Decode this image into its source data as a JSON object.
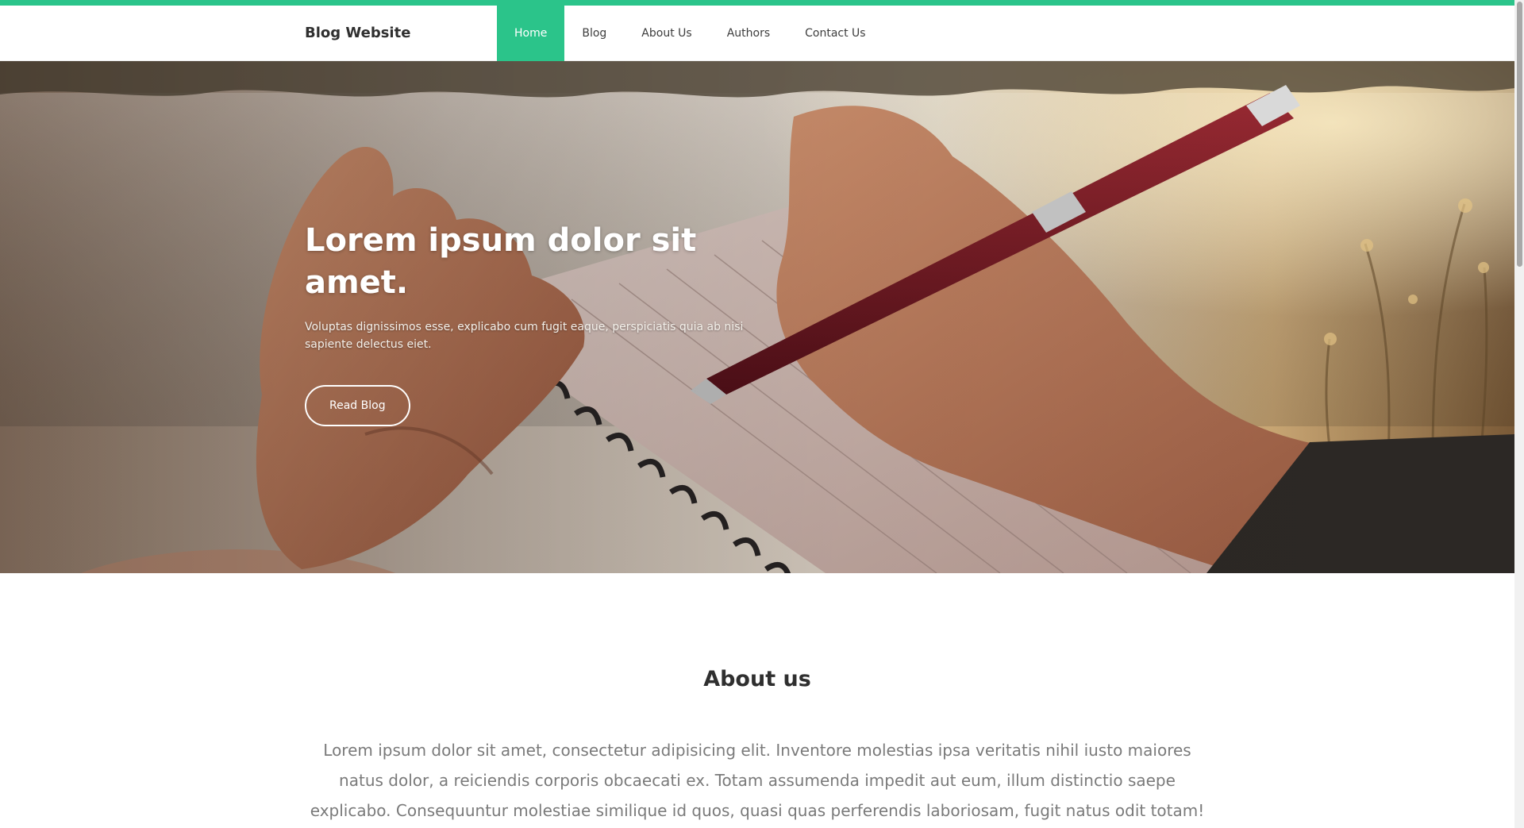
{
  "navbar": {
    "brand": "Blog Website",
    "links": [
      {
        "label": "Home",
        "active": true
      },
      {
        "label": "Blog",
        "active": false
      },
      {
        "label": "About Us",
        "active": false
      },
      {
        "label": "Authors",
        "active": false
      },
      {
        "label": "Contact Us",
        "active": false
      }
    ],
    "accent_color": "#2bc48a"
  },
  "hero": {
    "title": "Lorem ipsum dolor sit amet.",
    "text": "Voluptas dignissimos esse, explicabo cum fugit eaque, perspiciatis quia ab nisi sapiente delectus eiet.",
    "button_label": "Read Blog"
  },
  "about": {
    "title": "About us",
    "text": "Lorem ipsum dolor sit amet, consectetur adipisicing elit. Inventore molestias ipsa veritatis nihil iusto maiores natus dolor, a reiciendis corporis obcaecati ex. Totam assumenda impedit aut eum, illum distinctio saepe explicabo. Consequuntur molestiae similique id quos, quasi quas perferendis laboriosam, fugit natus odit totam! Id dolores saepe, sint debitis"
  }
}
